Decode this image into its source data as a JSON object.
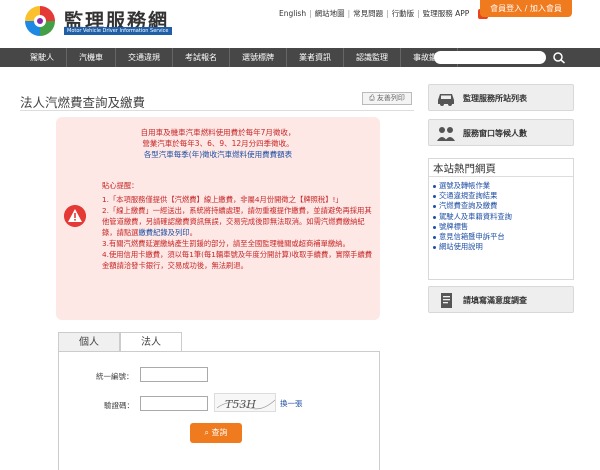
{
  "header": {
    "site_title": "監理服務網",
    "site_subtitle": "Motor Vehicle Driver Information Service",
    "top_links": [
      "English",
      "網站地圖",
      "常見問題",
      "行動版",
      "監理服務 APP"
    ],
    "login_label": "會員登入 / 加入會員",
    "app_icon_glyph": "K"
  },
  "nav": {
    "items": [
      "駕駛人",
      "汽機車",
      "交通違規",
      "考試報名",
      "選號標牌",
      "業者資訊",
      "認識監理",
      "事故鑑定"
    ],
    "search_placeholder": ""
  },
  "main": {
    "page_title": "法人汽燃費查詢及繳費",
    "print_label": "友善列印",
    "notice": {
      "line1": "自用車及機車汽車燃料使用費於每年7月徵收，",
      "line2": "營業汽車於每年3、6、9、12月分四季徵收。",
      "line3": "各型汽車每季(年)徵收汽車燃料使用費費額表",
      "tips_title": "貼心提醒：",
      "tip1": "1.「本項服務僅提供【汽燃費】線上繳費，非屬4月份開徵之【牌照稅】!」",
      "tip2_a": "2.「線上繳費」一經送出，系統將持續處理，請勿重複提作繳費，並請避免再採用其他管道繳費，另請確認繳費資訊無誤，交易完成後即無法取消。如需汽燃費繳納紀錄，請點選",
      "tip2_link": "繳費紀錄及列印",
      "tip2_b": "。",
      "tip3": "3.有關汽燃費延遲繳納產生罰鍰的部分，請至全國監理機關或超商補單繳納。",
      "tip4": "4.使用信用卡繳費，須以每1筆(每1輛車號及年度分開計算)收取手續費，實際手續費金額請洽發卡銀行，交易成功後，無法刷退。"
    },
    "tabs": [
      "個人",
      "法人"
    ],
    "active_tab": "法人",
    "form": {
      "tax_id_label": "統一編號：",
      "tax_id_value": "",
      "captcha_label": "驗證碼：",
      "captcha_value": "",
      "captcha_text": "T53H",
      "refresh_label": "換一張",
      "query_label": "查詢"
    }
  },
  "sidebar": {
    "buttons": [
      "監理服務所站列表",
      "服務窗口等候人數",
      "請填寫滿意度調查"
    ],
    "hot_title": "本站熱門網頁",
    "hot_links": [
      "選號及轉帳作業",
      "交通違規查詢結果",
      "汽燃費查詢及繳費",
      "駕駛人及車籍資料查詢",
      "號牌標售",
      "意見信箱暨申訴平台",
      "網站使用說明"
    ]
  },
  "colors": {
    "accent_orange": "#f07a1e",
    "nav_bg": "#474747",
    "notice_bg": "#fde8e6",
    "notice_text": "#c62828",
    "link_blue": "#1f4fa3"
  }
}
